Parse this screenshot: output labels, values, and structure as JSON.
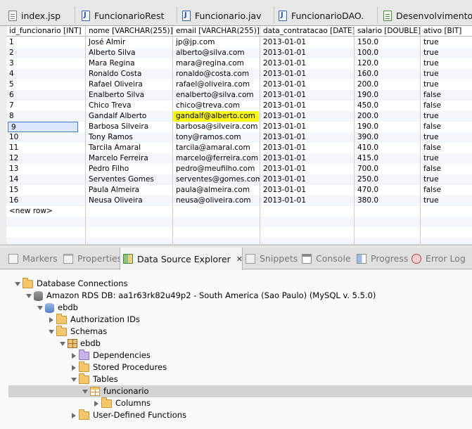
{
  "editor_tabs": [
    {
      "label": "index.jsp",
      "icon": "jsp-file-icon"
    },
    {
      "label": "FuncionarioRest",
      "icon": "java-file-icon"
    },
    {
      "label": "Funcionario.jav",
      "icon": "java-file-icon"
    },
    {
      "label": "FuncionarioDAO.",
      "icon": "java-file-icon"
    },
    {
      "label": "Desenvolvimento",
      "icon": "document-icon"
    }
  ],
  "table": {
    "columns": [
      "id_funcionario [INT]",
      "nome [VARCHAR(255)]",
      "email [VARCHAR(255)]",
      "data_contratacao [DATE]",
      "salario [DOUBLE]",
      "ativo [BIT]"
    ],
    "rows": [
      [
        "1",
        "José Almir",
        "jp@jp.com",
        "2013-01-01",
        "150.0",
        "true"
      ],
      [
        "2",
        "Alberto Silva",
        "alberto@silva.com",
        "2013-01-01",
        "100.0",
        "true"
      ],
      [
        "3",
        "Mara Regina",
        "mara@regina.com",
        "2013-01-01",
        "120.0",
        "true"
      ],
      [
        "4",
        "Ronaldo Costa",
        "ronaldo@costa.com",
        "2013-01-01",
        "160.0",
        "true"
      ],
      [
        "5",
        "Rafael Oliveira",
        "rafael@oliveira.com",
        "2013-01-01",
        "200.0",
        "true"
      ],
      [
        "6",
        "Enalberto Silva",
        "enalberto@silva.com",
        "2013-01-01",
        "190.0",
        "false"
      ],
      [
        "7",
        "Chico Treva",
        "chico@treva.com",
        "2013-01-01",
        "450.0",
        "false"
      ],
      [
        "8",
        "Gandalf Alberto",
        "gandalf@alberto.com",
        "2013-01-01",
        "200.0",
        "true"
      ],
      [
        "9",
        "Barbosa Silveira",
        "barbosa@silveira.com",
        "2013-01-01",
        "190.0",
        "false"
      ],
      [
        "10",
        "Tony Ramos",
        "tony@ramos.com",
        "2013-01-01",
        "390.0",
        "true"
      ],
      [
        "11",
        "Tarcila Amaral",
        "tarcila@amaral.com",
        "2013-01-01",
        "410.0",
        "false"
      ],
      [
        "12",
        "Marcelo Ferreira",
        "marcelo@ferreira.com",
        "2013-01-01",
        "415.0",
        "true"
      ],
      [
        "13",
        "Pedro Filho",
        "pedro@meufilho.com",
        "2013-01-01",
        "700.0",
        "false"
      ],
      [
        "14",
        "Serventes Gomes",
        "serventes@gomes.com",
        "2013-01-01",
        "250.0",
        "true"
      ],
      [
        "15",
        "Paula Almeira",
        "paula@almeira.com",
        "2013-01-01",
        "470.0",
        "false"
      ],
      [
        "16",
        "Neusa Oliveira",
        "neusa@oliveira.com",
        "2013-01-01",
        "380.0",
        "true"
      ]
    ],
    "new_row_label": "<new row>",
    "highlight_color": "#f7f71a"
  },
  "view_tabs": [
    {
      "label": "Markers",
      "icon": "markers-icon",
      "active": false
    },
    {
      "label": "Properties",
      "icon": "properties-icon",
      "active": false
    },
    {
      "label": "Data Source Explorer",
      "icon": "data-source-explorer-icon",
      "active": true,
      "close": "✕"
    },
    {
      "label": "Snippets",
      "icon": "snippets-icon",
      "active": false
    },
    {
      "label": "Console",
      "icon": "console-icon",
      "active": false
    },
    {
      "label": "Progress",
      "icon": "progress-icon",
      "active": false
    },
    {
      "label": "Error Log",
      "icon": "error-log-icon",
      "active": false
    }
  ],
  "tree": [
    {
      "label": "Database Connections",
      "depth": 0,
      "twisty": "open",
      "icon": "folder-icon"
    },
    {
      "label": "Amazon RDS DB: aa1r63rk82u49p2 - South America (Sao Paulo) (MySQL v. 5.5.0)",
      "depth": 1,
      "twisty": "open",
      "icon": "database-connection-icon"
    },
    {
      "label": "ebdb",
      "depth": 2,
      "twisty": "open",
      "icon": "database-icon"
    },
    {
      "label": "Authorization IDs",
      "depth": 3,
      "twisty": "closed",
      "icon": "folder-icon"
    },
    {
      "label": "Schemas",
      "depth": 3,
      "twisty": "open",
      "icon": "folder-icon"
    },
    {
      "label": "ebdb",
      "depth": 4,
      "twisty": "open",
      "icon": "schema-icon"
    },
    {
      "label": "Dependencies",
      "depth": 5,
      "twisty": "closed",
      "icon": "purple-folder-icon"
    },
    {
      "label": "Stored Procedures",
      "depth": 5,
      "twisty": "closed",
      "icon": "folder-icon"
    },
    {
      "label": "Tables",
      "depth": 5,
      "twisty": "open",
      "icon": "folder-icon"
    },
    {
      "label": "funcionario",
      "depth": 6,
      "twisty": "open",
      "icon": "table-icon",
      "selected": true
    },
    {
      "label": "Columns",
      "depth": 7,
      "twisty": "closed",
      "icon": "folder-icon"
    },
    {
      "label": "User-Defined Functions",
      "depth": 5,
      "twisty": "closed",
      "icon": "folder-icon"
    }
  ]
}
